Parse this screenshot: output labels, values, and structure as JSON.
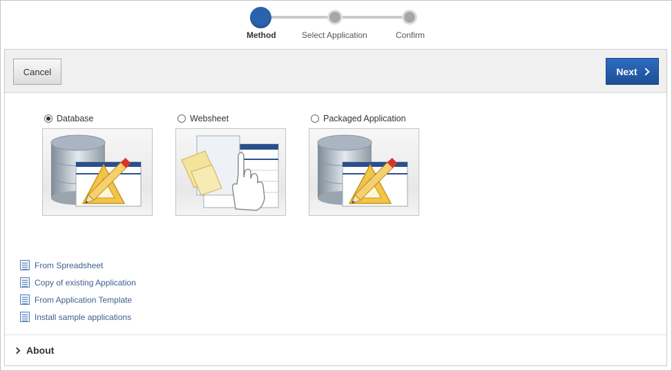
{
  "wizard": {
    "steps": [
      {
        "label": "Method",
        "active": true
      },
      {
        "label": "Select Application",
        "active": false
      },
      {
        "label": "Confirm",
        "active": false
      }
    ]
  },
  "toolbar": {
    "cancel_label": "Cancel",
    "next_label": "Next"
  },
  "methods": [
    {
      "label": "Database",
      "selected": true,
      "icon": "database-pencil-icon"
    },
    {
      "label": "Websheet",
      "selected": false,
      "icon": "websheet-hand-icon"
    },
    {
      "label": "Packaged Application",
      "selected": false,
      "icon": "packaged-database-pencil-icon"
    }
  ],
  "links": [
    {
      "label": "From Spreadsheet",
      "icon": "document-icon"
    },
    {
      "label": "Copy of existing Application",
      "icon": "document-icon"
    },
    {
      "label": "From Application Template",
      "icon": "document-icon"
    },
    {
      "label": "Install sample applications",
      "icon": "document-icon"
    }
  ],
  "about": {
    "label": "About",
    "icon": "chevron-right-icon"
  },
  "colors": {
    "accent": "#2a62ad",
    "link": "#3d5f8f",
    "toolbar_bg": "#f0f0f0"
  }
}
